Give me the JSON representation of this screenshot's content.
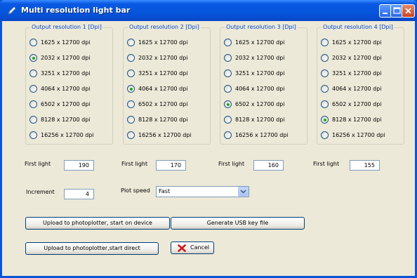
{
  "window": {
    "title": "Multi resolution light bar"
  },
  "groups": [
    {
      "legend": "Output resolution 1  [Dpi]",
      "selected_index": 1,
      "options": [
        "1625 x 12700 dpi",
        "2032 x 12700 dpi",
        "3251 x 12700 dpi",
        "4064 x 12700 dpi",
        "6502 x 12700 dpi",
        "8128 x 12700 dpi",
        "16256 x 12700 dpi"
      ]
    },
    {
      "legend": "Output resolution 2  [Dpi]",
      "selected_index": 3,
      "options": [
        "1625 x 12700 dpi",
        "2032 x 12700 dpi",
        "3251 x 12700 dpi",
        "4064 x 12700 dpi",
        "6502 x 12700 dpi",
        "8128 x 12700 dpi",
        "16256 x 12700 dpi"
      ]
    },
    {
      "legend": "Output resolution 3  [Dpi]",
      "selected_index": 4,
      "options": [
        "1625 x 12700 dpi",
        "2032 x 12700 dpi",
        "3251 x 12700 dpi",
        "4064 x 12700 dpi",
        "6502 x 12700 dpi",
        "8128 x 12700 dpi",
        "16256 x 12700 dpi"
      ]
    },
    {
      "legend": "Output resolution 4  [Dpi]",
      "selected_index": 5,
      "options": [
        "1625 x 12700 dpi",
        "2032 x 12700 dpi",
        "3251 x 12700 dpi",
        "4064 x 12700 dpi",
        "6502 x 12700 dpi",
        "8128 x 12700 dpi",
        "16256 x 12700 dpi"
      ]
    }
  ],
  "first_light": [
    {
      "label": "First light",
      "value": "190"
    },
    {
      "label": "First light",
      "value": "170"
    },
    {
      "label": "First light",
      "value": "160"
    },
    {
      "label": "First light",
      "value": "155"
    }
  ],
  "increment": {
    "label": "Increment",
    "value": "4"
  },
  "plot_speed": {
    "label": "Plot speed",
    "value": "Fast"
  },
  "buttons": {
    "upload_start_device": "Upload to photoplotter, start on device",
    "generate_usb": "Generate USB key file",
    "upload_start_direct": "Upload to photoplotter,start direct",
    "cancel": "Cancel"
  },
  "icons": {
    "title": "pencil-icon",
    "minimize": "minimize-icon",
    "maximize": "maximize-icon",
    "close": "close-icon",
    "cancel": "red-x-icon",
    "dropdown": "chevron-down-icon"
  },
  "colors": {
    "titlebar": "#0556dc",
    "legend": "#0046d5",
    "radio_dot": "#21a121",
    "cancel_icon": "#cc1b1b"
  }
}
